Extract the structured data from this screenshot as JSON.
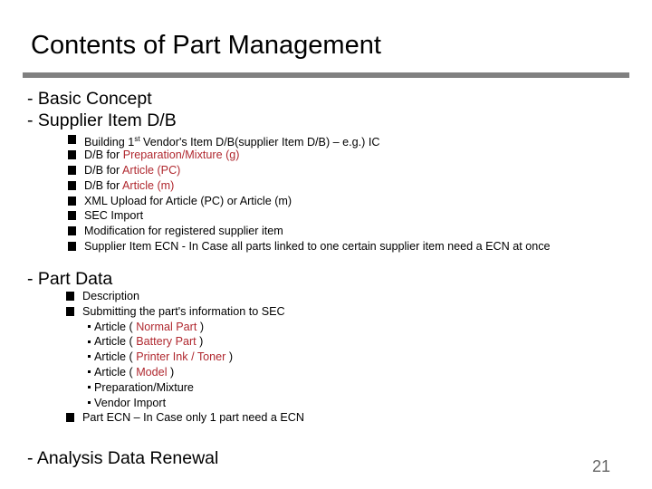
{
  "title": "Contents of Part Management",
  "sections": {
    "basic_concept": "- Basic Concept",
    "supplier_item": {
      "heading": "- Supplier Item D/B",
      "items": [
        {
          "pre": "Building 1",
          "sup": "st",
          "post": " Vendor's Item D/B(supplier Item D/B)  – e.g.) IC",
          "red": ""
        },
        {
          "pre": "D/B for ",
          "red": "Preparation/Mixture (g)",
          "post": ""
        },
        {
          "pre": "D/B for ",
          "red": "Article (PC)",
          "post": ""
        },
        {
          "pre": "D/B for ",
          "red": "Article (m)",
          "post": ""
        },
        {
          "pre": "XML Upload for Article (PC) or Article (m)",
          "red": "",
          "post": ""
        },
        {
          "pre": "SEC Import",
          "red": "",
          "post": ""
        },
        {
          "pre": "Modification for registered supplier item",
          "red": "",
          "post": ""
        },
        {
          "pre": "Supplier Item ECN  - In Case  all parts linked to one certain supplier item need a ECN at once",
          "red": "",
          "post": ""
        }
      ]
    },
    "part_data": {
      "heading": "- Part Data",
      "description": "Description",
      "submitting": "Submitting the part's information to SEC",
      "sub_items": [
        {
          "pre": "Article ( ",
          "red": "Normal Part",
          "post": " )"
        },
        {
          "pre": "Article ( ",
          "red": "Battery Part",
          "post": " )"
        },
        {
          "pre": "Article ( ",
          "red": "Printer Ink / Toner",
          "post": " )"
        },
        {
          "pre": "Article ( ",
          "red": "Model",
          "post": " )"
        },
        {
          "pre": "Preparation/Mixture",
          "red": "",
          "post": ""
        },
        {
          "pre": "Vendor Import",
          "red": "",
          "post": ""
        }
      ],
      "part_ecn": "Part ECN – In Case  only 1 part need a ECN"
    },
    "analysis": "- Analysis Data Renewal"
  },
  "page_number": "21",
  "colors": {
    "accent_red": "#b0282f",
    "rule_gray": "#808080"
  }
}
